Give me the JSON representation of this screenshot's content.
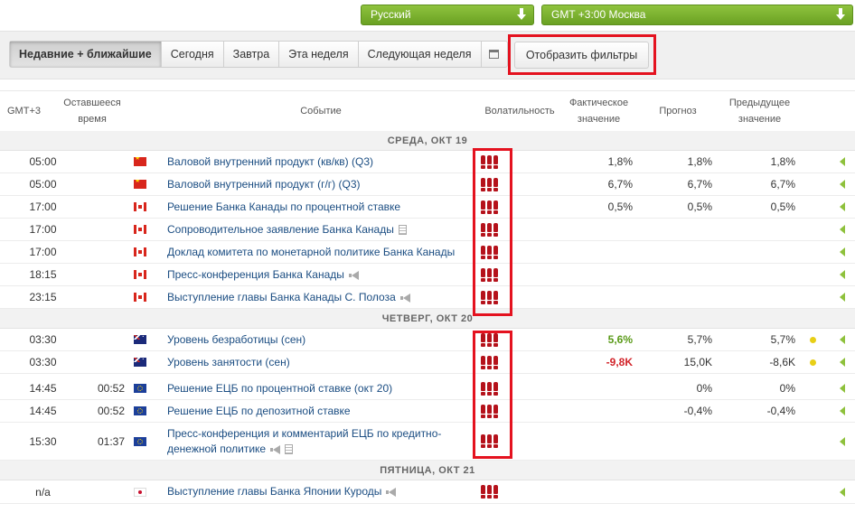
{
  "selectors": {
    "language": "Русский",
    "timezone": "GMT +3:00 Москва"
  },
  "tabs": [
    {
      "label": "Недавние + ближайшие",
      "active": true
    },
    {
      "label": "Сегодня",
      "active": false
    },
    {
      "label": "Завтра",
      "active": false
    },
    {
      "label": "Эта неделя",
      "active": false
    },
    {
      "label": "Следующая неделя",
      "active": false
    }
  ],
  "show_filters_label": "Отобразить фильтры",
  "columns": {
    "gmt": "GMT+3",
    "remaining_1": "Оставшееся",
    "remaining_2": "время",
    "event": "Событие",
    "volatility": "Волатильность",
    "actual_1": "Фактическое",
    "actual_2": "значение",
    "forecast": "Прогноз",
    "previous_1": "Предыдущее",
    "previous_2": "значение"
  },
  "days": {
    "wed": "СРЕДА, ОКТ 19",
    "thu": "ЧЕТВЕРГ, ОКТ 20",
    "fri": "ПЯТНИЦА, ОКТ 21"
  },
  "events": [
    {
      "time": "05:00",
      "remaining": "",
      "country": "cn",
      "event": "Валовой внутренний продукт (кв/кв) (Q3)",
      "actual": "1,8%",
      "forecast": "1,8%",
      "previous": "1,8%"
    },
    {
      "time": "05:00",
      "remaining": "",
      "country": "cn",
      "event": "Валовой внутренний продукт (г/г) (Q3)",
      "actual": "6,7%",
      "forecast": "6,7%",
      "previous": "6,7%"
    },
    {
      "time": "17:00",
      "remaining": "",
      "country": "ca",
      "event": "Решение Банка Канады по процентной ставке",
      "actual": "0,5%",
      "forecast": "0,5%",
      "previous": "0,5%"
    },
    {
      "time": "17:00",
      "remaining": "",
      "country": "ca",
      "event": "Сопроводительное заявление Банка Канады",
      "actual": "",
      "forecast": "",
      "previous": ""
    },
    {
      "time": "17:00",
      "remaining": "",
      "country": "ca",
      "event": "Доклад комитета по монетарной политике Банка Канады",
      "actual": "",
      "forecast": "",
      "previous": ""
    },
    {
      "time": "18:15",
      "remaining": "",
      "country": "ca",
      "event": "Пресс-конференция Банка Канады",
      "actual": "",
      "forecast": "",
      "previous": ""
    },
    {
      "time": "23:15",
      "remaining": "",
      "country": "ca",
      "event": "Выступление главы Банка Канады С. Полоза",
      "actual": "",
      "forecast": "",
      "previous": ""
    },
    {
      "time": "03:30",
      "remaining": "",
      "country": "au",
      "event": "Уровень безработицы (сен)",
      "actual": "5,6%",
      "forecast": "5,7%",
      "previous": "5,7%"
    },
    {
      "time": "03:30",
      "remaining": "",
      "country": "au",
      "event": "Уровень занятости (сен)",
      "actual": "-9,8K",
      "forecast": "15,0K",
      "previous": "-8,6K"
    },
    {
      "time": "14:45",
      "remaining": "00:52",
      "country": "eu",
      "event": "Решение ЕЦБ по процентной ставке (окт 20)",
      "actual": "",
      "forecast": "0%",
      "previous": "0%"
    },
    {
      "time": "14:45",
      "remaining": "00:52",
      "country": "eu",
      "event": "Решение ЕЦБ по депозитной ставке",
      "actual": "",
      "forecast": "-0,4%",
      "previous": "-0,4%"
    },
    {
      "time": "15:30",
      "remaining": "01:37",
      "country": "eu",
      "event": "Пресс-конференция и комментарий ЕЦБ по кредитно-денежной политике",
      "actual": "",
      "forecast": "",
      "previous": ""
    },
    {
      "time": "n/a",
      "remaining": "",
      "country": "jp",
      "event": "Выступление главы Банка Японии Куроды",
      "actual": "",
      "forecast": "",
      "previous": ""
    }
  ],
  "colors": {
    "accent_green": "#6aa123",
    "highlight_red": "#e4121f",
    "volatility_red": "#b5121b",
    "positive": "#5a9a18",
    "negative": "#d2242a"
  }
}
